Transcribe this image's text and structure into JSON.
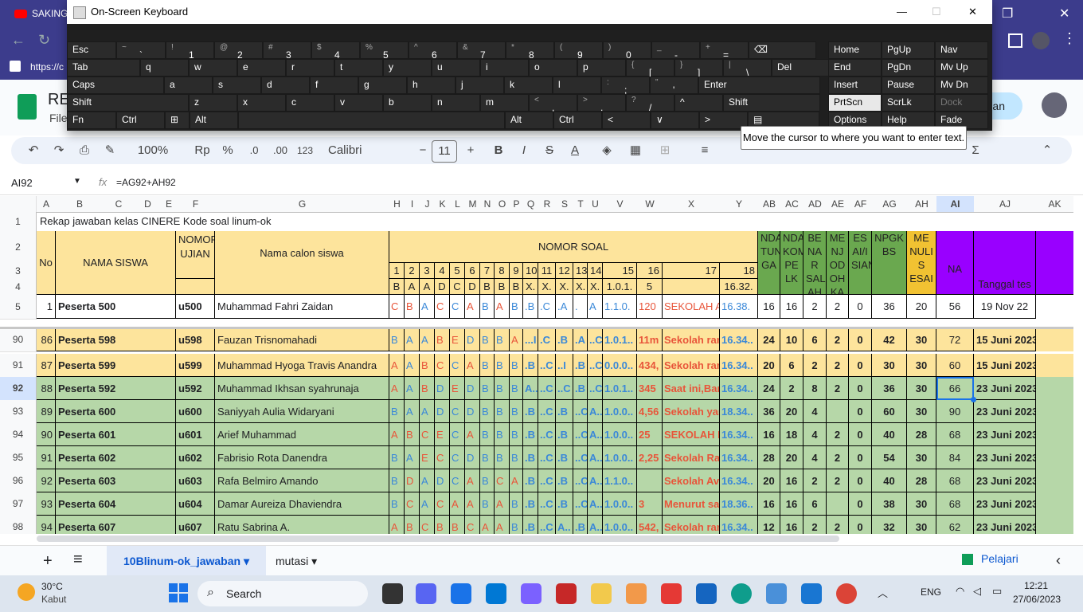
{
  "browser": {
    "tab_title": "SAKING",
    "url": "https://c",
    "minimize": "—",
    "restore": "❐",
    "close": "✕"
  },
  "sheets": {
    "doc_title": "RE",
    "menu_file": "File",
    "share_label": "an"
  },
  "toolbar": {
    "zoom": "100%",
    "currency": "Rp",
    "percent": "%",
    "dec_decrease": ".0",
    "dec_increase": ".00",
    "format_123": "123",
    "font": "Calibri",
    "font_size": "11",
    "bold": "B",
    "italic": "I",
    "strike": "S",
    "text_color": "A",
    "sigma": "Σ"
  },
  "formula_bar": {
    "cell_ref": "AI92",
    "fx": "fx",
    "formula": "=AG92+AH92"
  },
  "grid": {
    "columns": [
      "A",
      "B",
      "C",
      "D",
      "E",
      "F",
      "G",
      "H",
      "I",
      "J",
      "K",
      "L",
      "M",
      "N",
      "O",
      "P",
      "Q",
      "R",
      "S",
      "T",
      "U",
      "V",
      "W",
      "X",
      "Y",
      "AB",
      "AC",
      "AD",
      "AE",
      "AF",
      "AG",
      "AH",
      "AI",
      "AJ",
      "AK"
    ],
    "row_numbers": [
      "1",
      "2",
      "3",
      "4",
      "5",
      "90",
      "91",
      "92",
      "93",
      "94",
      "95",
      "96",
      "97",
      "98"
    ],
    "title_row": "Rekap jawaban kelas CINERE Kode soal linum-ok",
    "hdr_no": "No",
    "hdr_nama_siswa": "NAMA SISWA",
    "hdr_nomor_ujian": "NOMOR UJIAN",
    "hdr_nama_calon": "Nama calon siswa",
    "hdr_nomor_soal": "NOMOR SOAL",
    "soal_numbers": [
      "1",
      "2",
      "3",
      "4",
      "5",
      "6",
      "7",
      "8",
      "9",
      "10",
      "11",
      "12",
      "13",
      "14",
      "15",
      "16",
      "17",
      "18"
    ],
    "key_answers": [
      "B",
      "A",
      "A",
      "D",
      "C",
      "D",
      "B",
      "B",
      "B",
      "X.",
      "X.",
      "X.",
      "X.",
      "X.",
      "1.0.1.",
      "5",
      "",
      "16.32."
    ],
    "hdr_ab": "NDA TUNG GA",
    "hdr_ac": "NDA KOM PE LK",
    "hdr_ad": "BE NA R SAL AH",
    "hdr_ae": "ME NJ OD OH KA N",
    "hdr_af": "ES AI/I SIAN",
    "hdr_ag": "NPGK BS",
    "hdr_ah": "ME NULI S ESAI",
    "hdr_ai": "NA",
    "hdr_aj": "Tanggal tes",
    "row5": {
      "no": "1",
      "nama": "Peserta 500",
      "ujian": "u500",
      "calon": "Muhammad Fahri Zaidan",
      "ans": [
        "C",
        "B",
        "A",
        "C",
        "C",
        "A",
        "B",
        "A",
        "B",
        ".B",
        ".C",
        ".A",
        ".",
        "A",
        "1.1.0.",
        "120",
        "SEKOLAH AVICENNA",
        "16.38."
      ],
      "ab": "16",
      "ac": "16",
      "ad": "2",
      "ae": "2",
      "af": "0",
      "ag": "36",
      "ah": "20",
      "ai": "56",
      "aj": "19 Nov 22"
    },
    "rows": [
      {
        "no": "86",
        "nama": "Peserta 598",
        "ujian": "u598",
        "calon": "Fauzan Trisnomahadi",
        "ans": [
          "B",
          "A",
          "A",
          "B",
          "E",
          "D",
          "B",
          "B",
          "A",
          "...I",
          ".C",
          ".B",
          ".A",
          "..C",
          "1.0.1..",
          "11m",
          "Sekolah ran",
          "16.34.."
        ],
        "ab": "24",
        "ac": "10",
        "ad": "6",
        "ae": "2",
        "af": "0",
        "ag": "42",
        "ah": "30",
        "ai": "72",
        "aj": "15 Juni 2023",
        "bg": "#fde49c"
      },
      {
        "no": "87",
        "nama": "Peserta 599",
        "ujian": "u599",
        "calon": "Muhammad Hyoga Travis Anandra",
        "ans": [
          "A",
          "A",
          "B",
          "C",
          "C",
          "A",
          "B",
          "B",
          "B",
          ".B",
          "..C",
          "..I",
          ".B",
          "..C",
          "0.0.0..",
          "434,",
          "Sekolah ran",
          "16.34.."
        ],
        "ab": "20",
        "ac": "6",
        "ad": "2",
        "ae": "2",
        "af": "0",
        "ag": "30",
        "ah": "30",
        "ai": "60",
        "aj": "15 Juni 2023",
        "bg": "#fde49c"
      },
      {
        "no": "88",
        "nama": "Peserta 592",
        "ujian": "u592",
        "calon": "Muhammad Ikhsan syahrunaja",
        "ans": [
          "A",
          "A",
          "B",
          "D",
          "E",
          "D",
          "B",
          "B",
          "B",
          "A..",
          "..C",
          "..C",
          ".B",
          "..C",
          "1.0.1..",
          "345",
          "Saat ini,Bar",
          "16.34.."
        ],
        "ab": "24",
        "ac": "2",
        "ad": "8",
        "ae": "2",
        "af": "0",
        "ag": "36",
        "ah": "30",
        "ai": "66",
        "aj": "23 Juni 2023",
        "bg": "#b6d7a8"
      },
      {
        "no": "89",
        "nama": "Peserta 600",
        "ujian": "u600",
        "calon": "Saniyyah Aulia Widaryani",
        "ans": [
          "B",
          "A",
          "A",
          "D",
          "C",
          "D",
          "B",
          "B",
          "B",
          ".B",
          "..C",
          ".B",
          "..C",
          "A..",
          "1.0.0..",
          "4,56",
          "Sekolah yar",
          "18.34.."
        ],
        "ab": "36",
        "ac": "20",
        "ad": "4",
        "ae": "",
        "af": "0",
        "ag": "60",
        "ah": "30",
        "ai": "90",
        "aj": "23 Juni 2023",
        "bg": "#b6d7a8"
      },
      {
        "no": "90",
        "nama": "Peserta 601",
        "ujian": "u601",
        "calon": "Arief Muhammad",
        "ans": [
          "A",
          "B",
          "C",
          "E",
          "C",
          "A",
          "B",
          "B",
          "B",
          ".B",
          "..C",
          ".B",
          "..C",
          "A..",
          "1.0.0..",
          "25",
          "SEKOLAH R",
          "16.34.."
        ],
        "ab": "16",
        "ac": "18",
        "ad": "4",
        "ae": "2",
        "af": "0",
        "ag": "40",
        "ah": "28",
        "ai": "68",
        "aj": "23 Juni 2023",
        "bg": "#b6d7a8"
      },
      {
        "no": "91",
        "nama": "Peserta 602",
        "ujian": "u602",
        "calon": "Fabrisio Rota Danendra",
        "ans": [
          "B",
          "A",
          "E",
          "C",
          "C",
          "D",
          "B",
          "B",
          "B",
          ".B",
          "..C",
          ".B",
          "..C",
          "A..",
          "1.0.0..",
          "2,25",
          "Sekolah Ran",
          "16.34.."
        ],
        "ab": "28",
        "ac": "20",
        "ad": "4",
        "ae": "2",
        "af": "0",
        "ag": "54",
        "ah": "30",
        "ai": "84",
        "aj": "23 Juni 2023",
        "bg": "#b6d7a8"
      },
      {
        "no": "92",
        "nama": "Peserta 603",
        "ujian": "u603",
        "calon": "Rafa Belmiro Amando",
        "ans": [
          "B",
          "D",
          "A",
          "D",
          "C",
          "A",
          "B",
          "C",
          "A",
          ".B",
          "..C",
          ".B",
          "..C",
          "A..",
          "1.1.0..",
          "",
          "Sekolah Avi",
          "16.34.."
        ],
        "ab": "20",
        "ac": "16",
        "ad": "2",
        "ae": "2",
        "af": "0",
        "ag": "40",
        "ah": "28",
        "ai": "68",
        "aj": "23 Juni 2023",
        "bg": "#b6d7a8"
      },
      {
        "no": "93",
        "nama": "Peserta 604",
        "ujian": "u604",
        "calon": "Damar Aureiza Dhaviendra",
        "ans": [
          "B",
          "C",
          "A",
          "C",
          "A",
          "A",
          "B",
          "A",
          "B",
          ".B",
          "..C",
          ".B",
          "..C",
          "A..",
          "1.0.0..",
          "3",
          "Menurut sa",
          "18.36.."
        ],
        "ab": "16",
        "ac": "16",
        "ad": "6",
        "ae": "",
        "af": "0",
        "ag": "38",
        "ah": "30",
        "ai": "68",
        "aj": "23 Juni 2023",
        "bg": "#b6d7a8"
      },
      {
        "no": "94",
        "nama": "Peserta 607",
        "ujian": "u607",
        "calon": "Ratu Sabrina A.",
        "ans": [
          "A",
          "B",
          "C",
          "B",
          "B",
          "C",
          "A",
          "A",
          "B",
          ".B",
          "..C",
          "A..",
          ".B",
          "A..",
          "1.0.0..",
          "542,",
          "Sekolah ran",
          "16.34.."
        ],
        "ab": "12",
        "ac": "16",
        "ad": "2",
        "ae": "2",
        "af": "0",
        "ag": "32",
        "ah": "30",
        "ai": "62",
        "aj": "23 Juni 2023",
        "bg": "#b6d7a8"
      }
    ]
  },
  "keyboard": {
    "title": "On-Screen Keyboard",
    "minimize": "—",
    "maximize": "☐",
    "close": "✕",
    "rows": [
      [
        {
          "m": "Esc"
        },
        {
          "s": "~",
          "m": "`"
        },
        {
          "s": "!",
          "m": "1"
        },
        {
          "s": "@",
          "m": "2"
        },
        {
          "s": "#",
          "m": "3"
        },
        {
          "s": "$",
          "m": "4"
        },
        {
          "s": "%",
          "m": "5"
        },
        {
          "s": "^",
          "m": "6"
        },
        {
          "s": "&",
          "m": "7"
        },
        {
          "s": "*",
          "m": "8"
        },
        {
          "s": "(",
          "m": "9"
        },
        {
          "s": ")",
          "m": "0"
        },
        {
          "s": "_",
          "m": "-"
        },
        {
          "s": "+",
          "m": "="
        },
        {
          "m": "⌫"
        }
      ],
      [
        {
          "m": "Tab"
        },
        {
          "m": "q"
        },
        {
          "m": "w"
        },
        {
          "m": "e"
        },
        {
          "m": "r"
        },
        {
          "m": "t"
        },
        {
          "m": "y"
        },
        {
          "m": "u"
        },
        {
          "m": "i"
        },
        {
          "m": "o"
        },
        {
          "m": "p"
        },
        {
          "s": "{",
          "m": "["
        },
        {
          "s": "}",
          "m": "]"
        },
        {
          "s": "|",
          "m": "\\"
        },
        {
          "m": "Del"
        }
      ],
      [
        {
          "m": "Caps"
        },
        {
          "m": "a"
        },
        {
          "m": "s"
        },
        {
          "m": "d"
        },
        {
          "m": "f"
        },
        {
          "m": "g"
        },
        {
          "m": "h"
        },
        {
          "m": "j"
        },
        {
          "m": "k"
        },
        {
          "m": "l"
        },
        {
          "s": ":",
          "m": ";"
        },
        {
          "s": "\"",
          "m": "'"
        },
        {
          "m": "Enter"
        }
      ],
      [
        {
          "m": "Shift"
        },
        {
          "m": "z"
        },
        {
          "m": "x"
        },
        {
          "m": "c"
        },
        {
          "m": "v"
        },
        {
          "m": "b"
        },
        {
          "m": "n"
        },
        {
          "m": "m"
        },
        {
          "s": "<",
          "m": ","
        },
        {
          "s": ">",
          "m": "."
        },
        {
          "s": "?",
          "m": "/"
        },
        {
          "m": "^"
        },
        {
          "m": "Shift"
        }
      ],
      [
        {
          "m": "Fn"
        },
        {
          "m": "Ctrl"
        },
        {
          "m": "⊞"
        },
        {
          "m": "Alt"
        },
        {
          "m": ""
        },
        {
          "m": "Alt"
        },
        {
          "m": "Ctrl"
        },
        {
          "m": "<"
        },
        {
          "m": "∨"
        },
        {
          "m": ">"
        },
        {
          "m": "▤"
        }
      ]
    ],
    "side": [
      [
        "Home",
        "PgUp",
        "Nav"
      ],
      [
        "End",
        "PgDn",
        "Mv Up"
      ],
      [
        "Insert",
        "Pause",
        "Mv Dn"
      ],
      [
        "PrtScn",
        "ScrLk",
        "Dock"
      ],
      [
        "Options",
        "Help",
        "Fade"
      ]
    ],
    "tooltip": "Move the cursor to where you want to enter text."
  },
  "sheet_tabs": {
    "add": "+",
    "list": "≡",
    "active": "10Blinum-ok_jawaban",
    "other": "mutasi",
    "explore": "Pelajari"
  },
  "taskbar": {
    "temp": "30°C",
    "weather": "Kabut",
    "search": "Search",
    "lang": "ENG",
    "time": "12:21",
    "date": "27/06/2023"
  }
}
